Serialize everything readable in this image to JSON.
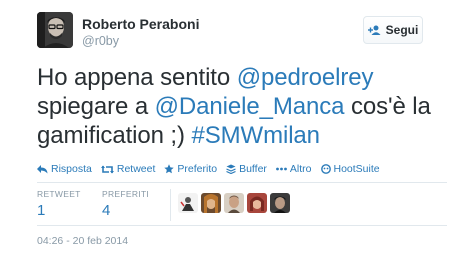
{
  "author": {
    "name": "Roberto Peraboni",
    "handle": "@r0by"
  },
  "follow_button": {
    "label": "Segui"
  },
  "tweet": {
    "segments": [
      {
        "text": "Ho appena sentito "
      },
      {
        "text": "@pedroelrey"
      },
      {
        "text": " spiegare a "
      },
      {
        "text": "@Daniele_Manca"
      },
      {
        "text": " cos'è la gamification ;) "
      },
      {
        "text": "#SMWmilan"
      }
    ]
  },
  "actions": [
    {
      "label": "Risposta",
      "icon": "reply-icon"
    },
    {
      "label": "Retweet",
      "icon": "retweet-icon"
    },
    {
      "label": "Preferito",
      "icon": "star-icon"
    },
    {
      "label": "Buffer",
      "icon": "buffer-icon"
    },
    {
      "label": "Altro",
      "icon": "more-icon"
    },
    {
      "label": "HootSuite",
      "icon": "hootsuite-icon"
    }
  ],
  "stats": {
    "retweets": {
      "label": "RETWEET",
      "value": "1"
    },
    "favorites": {
      "label": "PREFERITI",
      "value": "4"
    }
  },
  "timestamp": "04:26 - 20 feb 2014",
  "colors": {
    "link": "#2b7bb9",
    "text": "#292f33",
    "muted": "#8899a6",
    "border": "#e1e8ed"
  }
}
